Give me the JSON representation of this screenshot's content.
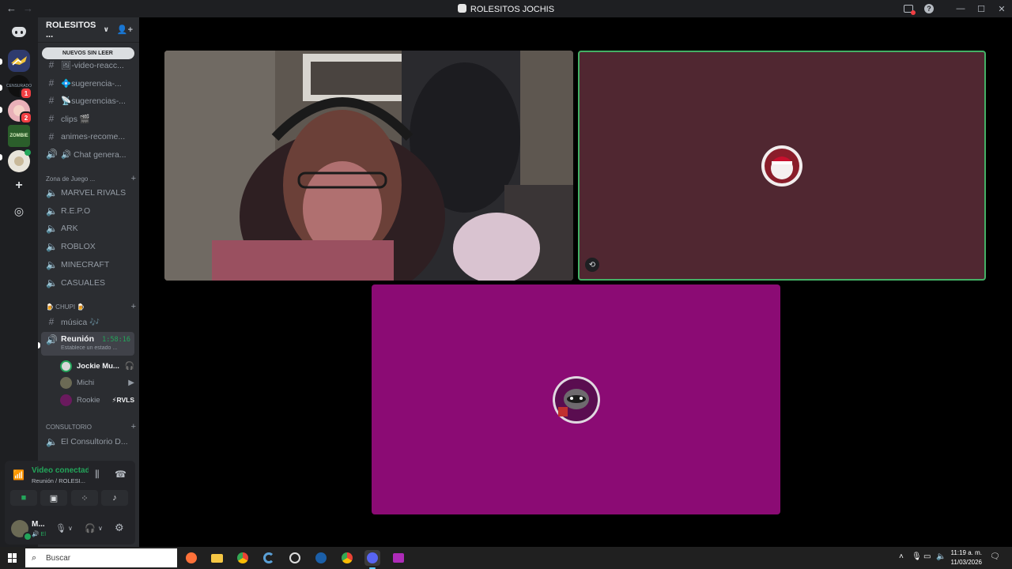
{
  "window": {
    "title": "ROLESITOS JOCHIS",
    "nav_back": "←",
    "nav_forward": "→"
  },
  "rail": {
    "home_label": "Discord",
    "servers": [
      {
        "name": "server-1",
        "color": "#2f3b6e",
        "badge": ""
      },
      {
        "name": "server-2",
        "color": "#101010",
        "badge": "1"
      },
      {
        "name": "server-3",
        "color": "#e9b0b8",
        "badge": "2"
      },
      {
        "name": "server-4",
        "color": "#2b5e2b",
        "badge": ""
      },
      {
        "name": "server-5",
        "color": "#e8e4da",
        "badge": ""
      }
    ],
    "add_server": "+",
    "discover": "◎"
  },
  "sidebar": {
    "server_name": "ROLESITOS ...",
    "unread_pill": "NUEVOS SIN LEER",
    "channels_top": [
      {
        "icon": "#",
        "label": "🖼-video-reacc..."
      },
      {
        "icon": "#",
        "label": "💠sugerencia-..."
      },
      {
        "icon": "#",
        "label": "📡sugerencias-..."
      },
      {
        "icon": "#",
        "label": "clips 🎬"
      },
      {
        "icon": "#",
        "label": "animes-recome..."
      },
      {
        "icon": "🔊",
        "label": "🔊 Chat genera..."
      }
    ],
    "category_games": "Zona de Juego ...",
    "game_channels": [
      "MARVEL RIVALS",
      "R.E.P.O",
      "ARK",
      "ROBLOX",
      "MINECRAFT",
      "CASUALES"
    ],
    "category_chupi": "🍺 CHUPI 🍺",
    "music_channel": "música 🎶",
    "active_channel": {
      "label": "Reunión",
      "timer": "1:58:16",
      "status": "Establece un estado ..."
    },
    "voice_users": [
      {
        "name": "Jockie Mu...",
        "tag": "",
        "indicator": "🎧",
        "color": "#c0c0c0"
      },
      {
        "name": "Michi",
        "tag": "",
        "indicator": "▶",
        "color": "#6b6a55"
      },
      {
        "name": "Rookie",
        "tag": "⚡RVLS",
        "indicator": "",
        "color": "#6a1a5e"
      }
    ],
    "category_consultorio": "CONSULTORIO",
    "consultorio_channel": "El Consultorio D..."
  },
  "voice_panel": {
    "status": "Video conectado",
    "location": "Reunión / ROLESI...",
    "user_name": "M...",
    "user_status": "🔊 El"
  },
  "taskbar": {
    "search_placeholder": "Buscar",
    "time": "11:19 a. m.",
    "date": "11/03/2026"
  },
  "colors": {
    "accent_green": "#23a55a",
    "tile_red": "#502731",
    "tile_purple": "#8b0b74"
  }
}
